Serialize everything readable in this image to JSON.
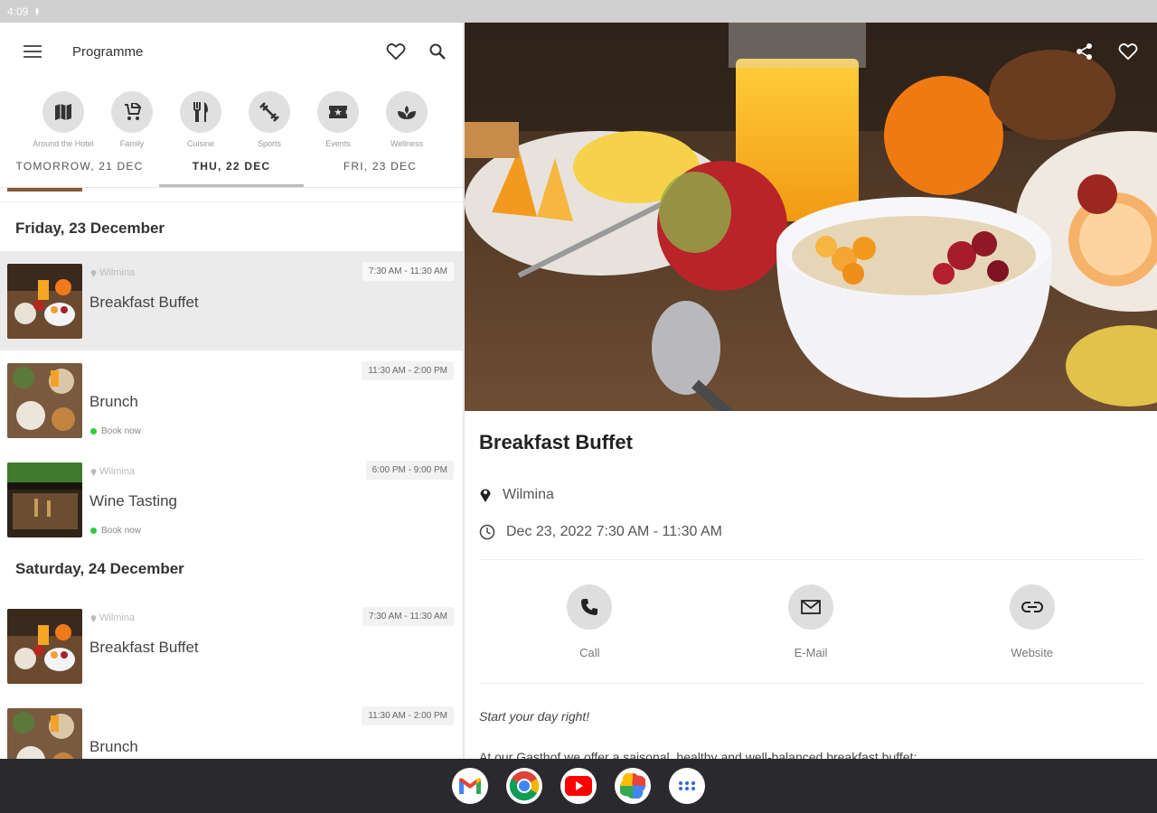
{
  "status_bar": {
    "time": "4:09"
  },
  "left": {
    "appbar": {
      "title": "Programme"
    },
    "categories": [
      {
        "label": "Around the Hotel",
        "icon": "map-icon"
      },
      {
        "label": "Family",
        "icon": "stroller-icon"
      },
      {
        "label": "Cuisine",
        "icon": "cutlery-icon"
      },
      {
        "label": "Sports",
        "icon": "fitness-icon"
      },
      {
        "label": "Events",
        "icon": "ticket-icon"
      },
      {
        "label": "Wellness",
        "icon": "spa-icon"
      }
    ],
    "tabs": [
      {
        "label": "TOMORROW, 21 DEC"
      },
      {
        "label": "THU, 22 DEC"
      },
      {
        "label": "FRI, 23 DEC"
      }
    ],
    "days": [
      {
        "header": "Friday, 23 December",
        "events": [
          {
            "location": "Wilmina",
            "name": "Breakfast Buffet",
            "time": "7:30 AM - 11:30 AM",
            "book": ""
          },
          {
            "location": "",
            "name": "Brunch",
            "time": "11:30 AM - 2:00 PM",
            "book": "Book now"
          },
          {
            "location": "Wilmina",
            "name": "Wine Tasting",
            "time": "6:00 PM - 9:00 PM",
            "book": "Book now"
          }
        ]
      },
      {
        "header": "Saturday, 24 December",
        "events": [
          {
            "location": "Wilmina",
            "name": "Breakfast Buffet",
            "time": "7:30 AM - 11:30 AM",
            "book": ""
          },
          {
            "location": "",
            "name": "Brunch",
            "time": "11:30 AM - 2:00 PM",
            "book": ""
          }
        ]
      }
    ]
  },
  "detail": {
    "title": "Breakfast Buffet",
    "location": "Wilmina",
    "datetime": "Dec 23, 2022 7:30 AM - 11:30 AM",
    "contacts": [
      {
        "label": "Call",
        "icon": "phone-icon"
      },
      {
        "label": "E-Mail",
        "icon": "mail-icon"
      },
      {
        "label": "Website",
        "icon": "link-icon"
      }
    ],
    "intro": "Start your day right!",
    "body": "At our Gasthof we offer a saisonal, healthy and well-balanced breakfast buffet:"
  },
  "dock": {
    "apps": [
      "gmail-icon",
      "chrome-icon",
      "youtube-icon",
      "photos-icon",
      "app-launcher-icon"
    ]
  },
  "colors": {
    "book_dot": "#2ecc40",
    "selected_row": "#ebebeb",
    "dock_bg": "#2a2a2e"
  }
}
